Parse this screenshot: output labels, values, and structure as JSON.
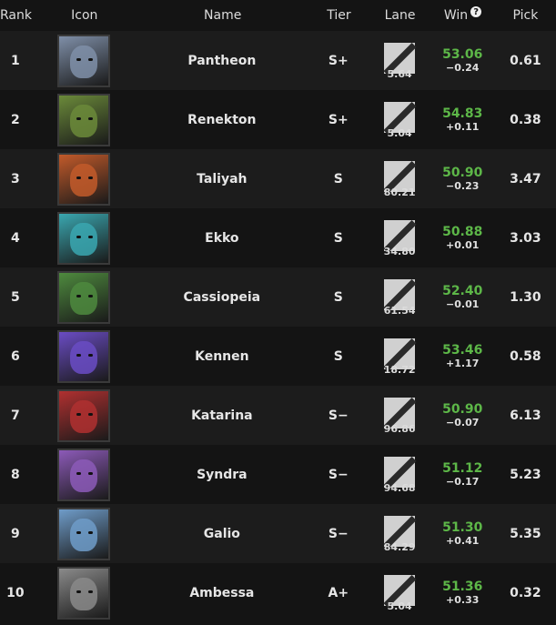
{
  "header": {
    "rank": "Rank",
    "icon": "Icon",
    "name": "Name",
    "tier": "Tier",
    "lane": "Lane",
    "win": "Win",
    "win_help": "?",
    "pick": "Pick"
  },
  "colors": {
    "win_positive": "#5db748",
    "row_alt": "#1c1c1c",
    "row_base": "#141414"
  },
  "rows": [
    {
      "rank": "1",
      "name": "Pantheon",
      "tier": "S+",
      "lane": "5.64",
      "win": "53.06",
      "delta": "−0.24",
      "pick": "0.61",
      "icon": "pantheon-portrait",
      "portrait_color": "#7f8fa8"
    },
    {
      "rank": "2",
      "name": "Renekton",
      "tier": "S+",
      "lane": "5.04",
      "win": "54.83",
      "delta": "+0.11",
      "pick": "0.38",
      "icon": "renekton-portrait",
      "portrait_color": "#6b8a3a"
    },
    {
      "rank": "3",
      "name": "Taliyah",
      "tier": "S",
      "lane": "80.21",
      "win": "50.90",
      "delta": "−0.23",
      "pick": "3.47",
      "icon": "taliyah-portrait",
      "portrait_color": "#c25a2a"
    },
    {
      "rank": "4",
      "name": "Ekko",
      "tier": "S",
      "lane": "34.80",
      "win": "50.88",
      "delta": "+0.01",
      "pick": "3.03",
      "icon": "ekko-portrait",
      "portrait_color": "#3aa7b0"
    },
    {
      "rank": "5",
      "name": "Cassiopeia",
      "tier": "S",
      "lane": "61.54",
      "win": "52.40",
      "delta": "−0.01",
      "pick": "1.30",
      "icon": "cassiopeia-portrait",
      "portrait_color": "#4e8a3e"
    },
    {
      "rank": "6",
      "name": "Kennen",
      "tier": "S",
      "lane": "18.72",
      "win": "53.46",
      "delta": "+1.17",
      "pick": "0.58",
      "icon": "kennen-portrait",
      "portrait_color": "#6a4cc4"
    },
    {
      "rank": "7",
      "name": "Katarina",
      "tier": "S−",
      "lane": "96.86",
      "win": "50.90",
      "delta": "−0.07",
      "pick": "6.13",
      "icon": "katarina-portrait",
      "portrait_color": "#b03030"
    },
    {
      "rank": "8",
      "name": "Syndra",
      "tier": "S−",
      "lane": "94.68",
      "win": "51.12",
      "delta": "−0.17",
      "pick": "5.23",
      "icon": "syndra-portrait",
      "portrait_color": "#8c5ab8"
    },
    {
      "rank": "9",
      "name": "Galio",
      "tier": "S−",
      "lane": "84.29",
      "win": "51.30",
      "delta": "+0.41",
      "pick": "5.35",
      "icon": "galio-portrait",
      "portrait_color": "#6f9cc9"
    },
    {
      "rank": "10",
      "name": "Ambessa",
      "tier": "A+",
      "lane": "5.04",
      "win": "51.36",
      "delta": "+0.33",
      "pick": "0.32",
      "icon": "ambessa-portrait",
      "portrait_color": "#8a8a8a"
    }
  ]
}
